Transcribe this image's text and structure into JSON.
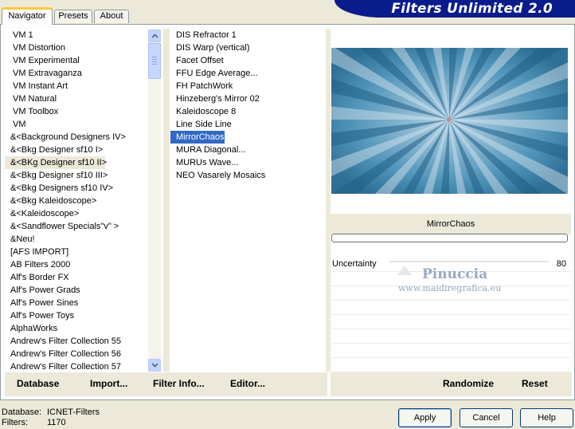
{
  "tabs": [
    "Navigator",
    "Presets",
    "About"
  ],
  "app_title": "Filters Unlimited 2.0",
  "categories": [
    "VM 1",
    "VM Distortion",
    "VM Experimental",
    "VM Extravaganza",
    "VM Instant Art",
    "VM Natural",
    "VM Toolbox",
    "VM",
    "&<Background Designers IV>",
    "&<Bkg Designer sf10 I>",
    "&<BKg Designer sf10 II>",
    "&<Bkg Designer sf10 III>",
    "&<Bkg Designers sf10 IV>",
    "&<Bkg Kaleidoscope>",
    "&<Kaleidoscope>",
    "&<Sandflower Specials\"v\" >",
    "&Neu!",
    "[AFS IMPORT]",
    "AB Filters 2000",
    "Alf's Border FX",
    "Alf's Power Grads",
    "Alf's Power Sines",
    "Alf's Power Toys",
    "AlphaWorks",
    "Andrew's Filter Collection 55",
    "Andrew's Filter Collection 56",
    "Andrew's Filter Collection 57"
  ],
  "selected_category": "&<BKg Designer sf10 II>",
  "filters": [
    "DIS Refractor 1",
    "DIS Warp (vertical)",
    "Facet Offset",
    "FFU Edge Average...",
    "FH PatchWork",
    "Hinzeberg's Mirror 02",
    "Kaleidoscope 8",
    "Line Side Line",
    "MirrorChaos",
    "MURA Diagonal...",
    "MURUs Wave...",
    "NEO Vasarely Mosaics"
  ],
  "selected_filter": "MirrorChaos",
  "preview_filter_name": "MirrorChaos",
  "parameter": {
    "label": "Uncertainty",
    "value": "80"
  },
  "watermark": {
    "name": "Pinuccia",
    "url": "www.maidiregrafica.eu"
  },
  "bottom_buttons": {
    "database": "Database",
    "import": "Import...",
    "filter_info": "Filter Info...",
    "editor": "Editor...",
    "randomize": "Randomize",
    "reset": "Reset"
  },
  "status": {
    "database_label": "Database:",
    "database_value": "ICNET-Filters",
    "filters_label": "Filters:",
    "filters_value": "1170"
  },
  "dialog_buttons": {
    "apply": "Apply",
    "cancel": "Cancel",
    "help": "Help"
  },
  "colors": {
    "selection": "#316ac5",
    "title_bar": "#0a1c8c",
    "tab_highlight": "#ffc83c"
  }
}
